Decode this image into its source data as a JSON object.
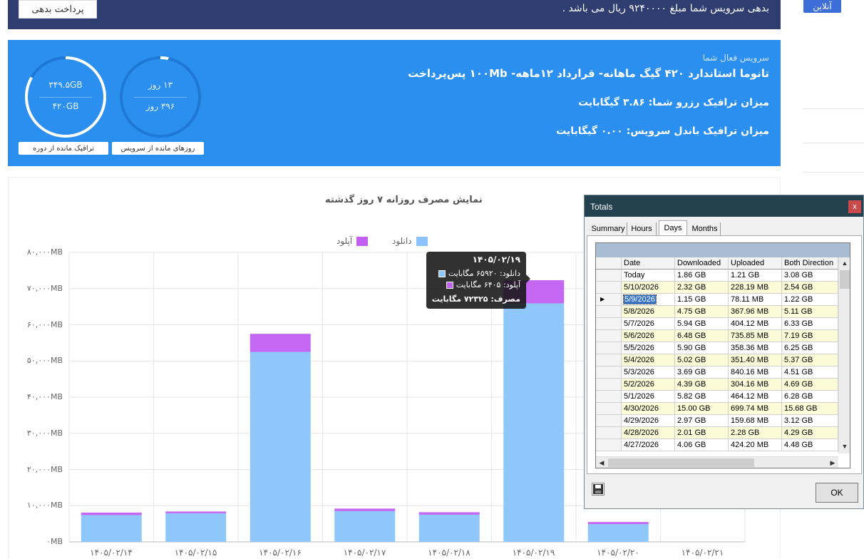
{
  "debt": {
    "pay_button": "پرداخت بدهی",
    "message": "بدهی سرویس شما مبلغ ۹۲۴۰۰۰۰ ریال می باشد ."
  },
  "sidebar": {
    "online_badge": "آنلاین"
  },
  "service": {
    "heading": "سرویس فعال شما",
    "plan": "تانوما استاندارد ۴۲۰ گیگ ماهانه- قرارداد ۱۲ماهه- ۱۰۰Mb پس‌پرداخت",
    "reserve_traffic": "میزان ترافیک رزرو شما: ۳.۸۶ گیگابایت",
    "bundle_traffic": "میزان ترافیک باندل سرویس: ۰.۰۰ گیگابایت",
    "days_gauge": {
      "top": "۱۳ روز",
      "bottom": "۳۹۶ روز",
      "label": "روزهای مانده از سرویس",
      "fraction": 0.033
    },
    "traffic_gauge": {
      "top": "۳۴۹.۵GB",
      "bottom": "۴۲۰GB",
      "label": "ترافیک مانده از دوره",
      "fraction": 0.832
    }
  },
  "chart_data": {
    "type": "bar",
    "stacked": true,
    "title": "نمایش مصرف روزانه ۷ روز گذشته",
    "categories": [
      "۱۴۰۵/۰۲/۱۴",
      "۱۴۰۵/۰۲/۱۵",
      "۱۴۰۵/۰۲/۱۶",
      "۱۴۰۵/۰۲/۱۷",
      "۱۴۰۵/۰۲/۱۸",
      "۱۴۰۵/۰۲/۱۹",
      "۱۴۰۵/۰۲/۲۰",
      "۱۴۰۵/۰۲/۲۱"
    ],
    "series": [
      {
        "name": "دانلود",
        "color": "#8ac4fb",
        "values": [
          7400,
          7900,
          52500,
          8500,
          7500,
          65920,
          4900,
          0
        ]
      },
      {
        "name": "آپلود",
        "color": "#c15ff1",
        "values": [
          700,
          500,
          5000,
          700,
          700,
          6405,
          600,
          0
        ]
      }
    ],
    "y_ticks": [
      "۰MB",
      "۱۰,۰۰۰MB",
      "۲۰,۰۰۰MB",
      "۳۰,۰۰۰MB",
      "۴۰,۰۰۰MB",
      "۵۰,۰۰۰MB",
      "۶۰,۰۰۰MB",
      "۷۰,۰۰۰MB",
      "۸۰,۰۰۰MB"
    ],
    "ylim": [
      0,
      80000
    ],
    "grid": true,
    "legend": "top-center",
    "tooltip": {
      "date": "۱۴۰۵/۰۲/۱۹",
      "download": "دانلود: ۶۵۹۲۰ مگابایت",
      "upload": "آپلود: ۶۴۰۵ مگابایت",
      "total": "مصرف: ۷۲۳۲۵ مگابایت"
    }
  },
  "totals_window": {
    "title": "Totals",
    "close": "x",
    "tabs": [
      "Summary",
      "Hours",
      "Days",
      "Months"
    ],
    "active_tab": "Days",
    "columns": [
      "Date",
      "Downloaded",
      "Uploaded",
      "Both Direction"
    ],
    "rows": [
      [
        "Today",
        "1.86 GB",
        "1.21 GB",
        "3.08 GB"
      ],
      [
        "5/10/2026",
        "2.32 GB",
        "228.19 MB",
        "2.54 GB"
      ],
      [
        "5/9/2026",
        "1.15 GB",
        "78.11 MB",
        "1.22 GB"
      ],
      [
        "5/8/2026",
        "4.75 GB",
        "367.96 MB",
        "5.11 GB"
      ],
      [
        "5/7/2026",
        "5.94 GB",
        "404.12 MB",
        "6.33 GB"
      ],
      [
        "5/6/2026",
        "6.48 GB",
        "735.85 MB",
        "7.19 GB"
      ],
      [
        "5/5/2026",
        "5.90 GB",
        "358.36 MB",
        "6.25 GB"
      ],
      [
        "5/4/2026",
        "5.02 GB",
        "351.40 MB",
        "5.37 GB"
      ],
      [
        "5/3/2026",
        "3.69 GB",
        "840.16 MB",
        "4.51 GB"
      ],
      [
        "5/2/2026",
        "4.39 GB",
        "304.16 MB",
        "4.69 GB"
      ],
      [
        "5/1/2026",
        "5.82 GB",
        "464.12 MB",
        "6.28 GB"
      ],
      [
        "4/30/2026",
        "15.00 GB",
        "699.74 MB",
        "15.68 GB"
      ],
      [
        "4/29/2026",
        "2.97 GB",
        "159.68 MB",
        "3.12 GB"
      ],
      [
        "4/28/2026",
        "2.01 GB",
        "2.28 GB",
        "4.29 GB"
      ],
      [
        "4/27/2026",
        "4.06 GB",
        "424.20 MB",
        "4.48 GB"
      ]
    ],
    "selected_row": 2,
    "ok_button": "OK"
  }
}
